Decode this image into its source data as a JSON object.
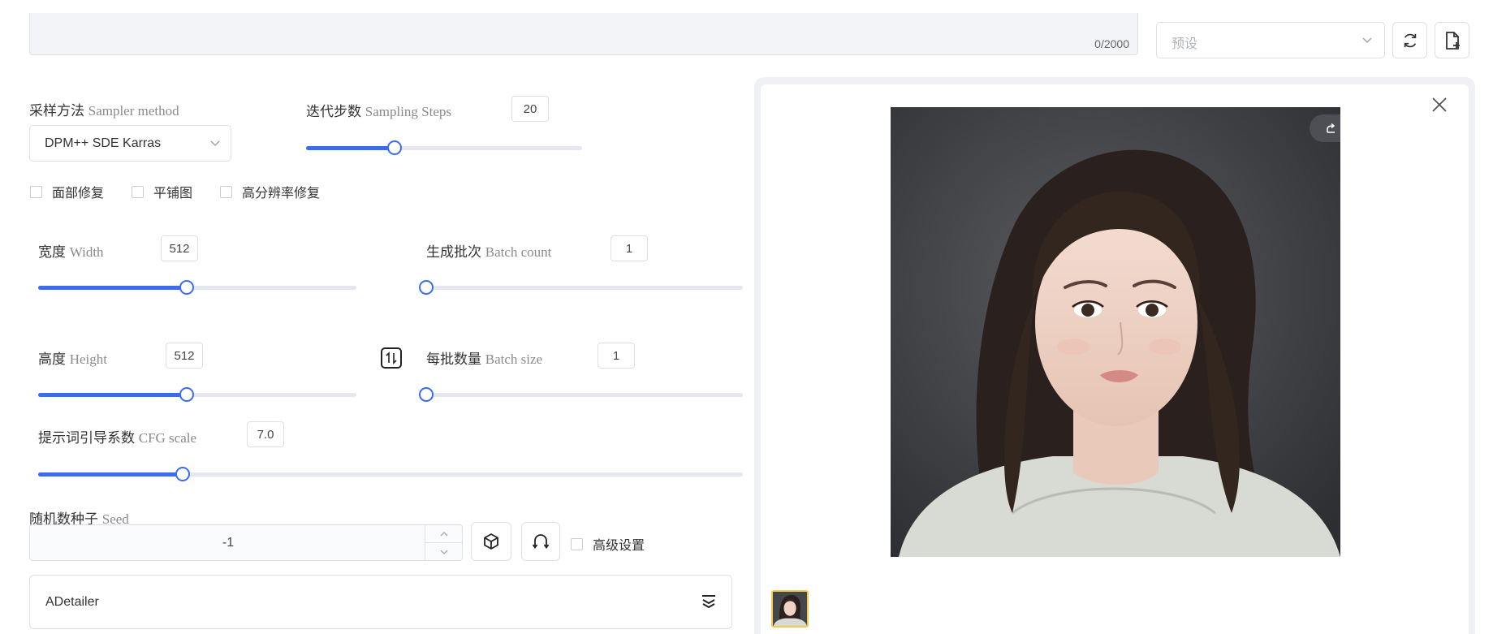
{
  "prompt": {
    "char_count": "0/2000"
  },
  "preset": {
    "placeholder": "预设"
  },
  "sampler": {
    "label_cn": "采样方法",
    "label_en": "Sampler method",
    "selected": "DPM++ SDE Karras"
  },
  "steps": {
    "label_cn": "迭代步数",
    "label_en": "Sampling Steps",
    "value": "20",
    "fraction": 0.32
  },
  "checkboxes": {
    "face_restore": "面部修复",
    "tiling": "平铺图",
    "hires_fix": "高分辨率修复"
  },
  "width": {
    "label_cn": "宽度",
    "label_en": "Width",
    "value": "512",
    "fraction": 0.466
  },
  "height": {
    "label_cn": "高度",
    "label_en": "Height",
    "value": "512",
    "fraction": 0.466
  },
  "batch_count": {
    "label_cn": "生成批次",
    "label_en": "Batch count",
    "value": "1",
    "fraction": 0
  },
  "batch_size": {
    "label_cn": "每批数量",
    "label_en": "Batch size",
    "value": "1",
    "fraction": 0
  },
  "cfg": {
    "label_cn": "提示词引导系数",
    "label_en": "CFG scale",
    "value": "7.0",
    "fraction": 0.205
  },
  "seed": {
    "label_cn": "随机数种子",
    "label_en": "Seed",
    "value": "-1",
    "advanced_label": "高级设置"
  },
  "adetailer": {
    "label": "ADetailer"
  },
  "preview": {
    "share_label": "分享"
  },
  "colors": {
    "accent": "#3b6cf0",
    "thumb_border": "#f2c94c",
    "share_bg": "#4d4f55"
  }
}
